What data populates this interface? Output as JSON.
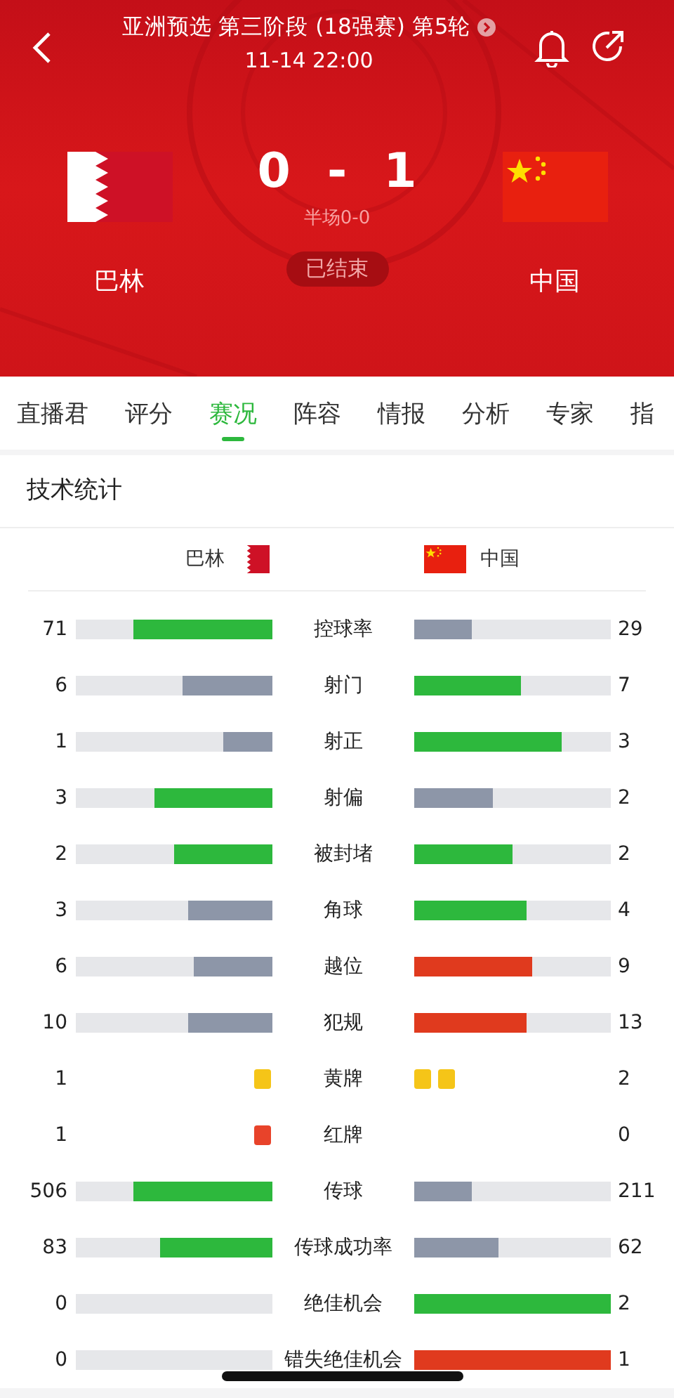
{
  "header": {
    "title": "亚洲预选 第三阶段 (18强赛) 第5轮",
    "time": "11-14 22:00",
    "home": {
      "name": "巴林"
    },
    "away": {
      "name": "中国"
    },
    "score_home": "0",
    "score_separator": "-",
    "score_away": "1",
    "half_time": "半场0-0",
    "status": "已结束"
  },
  "tabs": [
    {
      "label": "直播君",
      "selected": false
    },
    {
      "label": "评分",
      "selected": false
    },
    {
      "label": "赛况",
      "selected": true
    },
    {
      "label": "阵容",
      "selected": false
    },
    {
      "label": "情报",
      "selected": false
    },
    {
      "label": "分析",
      "selected": false
    },
    {
      "label": "专家",
      "selected": false
    },
    {
      "label": "指",
      "selected": false
    }
  ],
  "stats_panel": {
    "title": "技术统计",
    "home_team": "巴林",
    "away_team": "中国",
    "stats": [
      {
        "label": "控球率",
        "kind": "bar",
        "home": {
          "value": "71",
          "level": 0.71,
          "color": "#2db83d"
        },
        "away": {
          "value": "29",
          "level": 0.29,
          "color": "#8d96a8"
        }
      },
      {
        "label": "射门",
        "kind": "bar",
        "home": {
          "value": "6",
          "level": 0.46,
          "color": "#8d96a8"
        },
        "away": {
          "value": "7",
          "level": 0.54,
          "color": "#2db83d"
        }
      },
      {
        "label": "射正",
        "kind": "bar",
        "home": {
          "value": "1",
          "level": 0.25,
          "color": "#8d96a8"
        },
        "away": {
          "value": "3",
          "level": 0.75,
          "color": "#2db83d"
        }
      },
      {
        "label": "射偏",
        "kind": "bar",
        "home": {
          "value": "3",
          "level": 0.6,
          "color": "#2db83d"
        },
        "away": {
          "value": "2",
          "level": 0.4,
          "color": "#8d96a8"
        }
      },
      {
        "label": "被封堵",
        "kind": "bar",
        "home": {
          "value": "2",
          "level": 0.5,
          "color": "#2db83d"
        },
        "away": {
          "value": "2",
          "level": 0.5,
          "color": "#2db83d"
        }
      },
      {
        "label": "角球",
        "kind": "bar",
        "home": {
          "value": "3",
          "level": 0.43,
          "color": "#8d96a8"
        },
        "away": {
          "value": "4",
          "level": 0.57,
          "color": "#2db83d"
        }
      },
      {
        "label": "越位",
        "kind": "bar",
        "home": {
          "value": "6",
          "level": 0.4,
          "color": "#8d96a8"
        },
        "away": {
          "value": "9",
          "level": 0.6,
          "color": "#e03a1e"
        }
      },
      {
        "label": "犯规",
        "kind": "bar",
        "home": {
          "value": "10",
          "level": 0.43,
          "color": "#8d96a8"
        },
        "away": {
          "value": "13",
          "level": 0.57,
          "color": "#e03a1e"
        }
      },
      {
        "label": "黄牌",
        "kind": "cards",
        "home": {
          "value": "1",
          "cards": [
            {
              "color": "#f5c518"
            }
          ]
        },
        "away": {
          "value": "2",
          "cards": [
            {
              "color": "#f5c518"
            },
            {
              "color": "#f5c518"
            }
          ]
        }
      },
      {
        "label": "红牌",
        "kind": "cards",
        "home": {
          "value": "1",
          "cards": [
            {
              "color": "#e8432a"
            }
          ]
        },
        "away": {
          "value": "0"
        }
      },
      {
        "label": "传球",
        "kind": "bar",
        "home": {
          "value": "506",
          "level": 0.71,
          "color": "#2db83d"
        },
        "away": {
          "value": "211",
          "level": 0.29,
          "color": "#8d96a8"
        }
      },
      {
        "label": "传球成功率",
        "kind": "bar",
        "home": {
          "value": "83",
          "level": 0.57,
          "color": "#2db83d"
        },
        "away": {
          "value": "62",
          "level": 0.43,
          "color": "#8d96a8"
        }
      },
      {
        "label": "绝佳机会",
        "kind": "bar",
        "home": {
          "value": "0"
        },
        "away": {
          "value": "2",
          "level": 1,
          "color": "#2db83d"
        }
      },
      {
        "label": "错失绝佳机会",
        "kind": "bar",
        "home": {
          "value": "0"
        },
        "away": {
          "value": "1",
          "level": 1,
          "color": "#e03a1e"
        }
      }
    ]
  }
}
